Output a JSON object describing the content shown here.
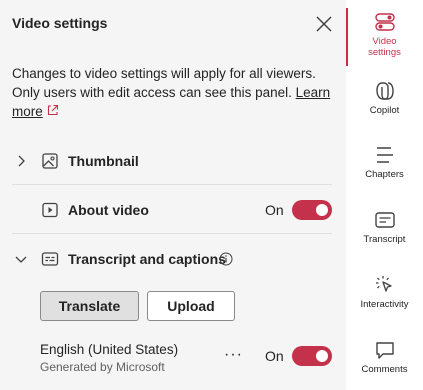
{
  "panel": {
    "title": "Video settings",
    "description": "Changes to video settings will apply for all viewers. Only users with edit access can see this panel.",
    "learn_more": "Learn more"
  },
  "sections": {
    "thumbnail": "Thumbnail",
    "about_video": "About video",
    "about_video_state": "On",
    "transcript": "Transcript and captions"
  },
  "transcript": {
    "translate_label": "Translate",
    "upload_label": "Upload",
    "language": "English (United States)",
    "generated_by": "Generated by Microsoft",
    "more": "···",
    "state": "On"
  },
  "rail": {
    "video_settings": "Video settings",
    "copilot": "Copilot",
    "chapters": "Chapters",
    "transcript": "Transcript",
    "interactivity": "Interactivity",
    "comments": "Comments"
  },
  "colors": {
    "accent": "#c4314b",
    "panel_bg": "#f5f5f5"
  }
}
